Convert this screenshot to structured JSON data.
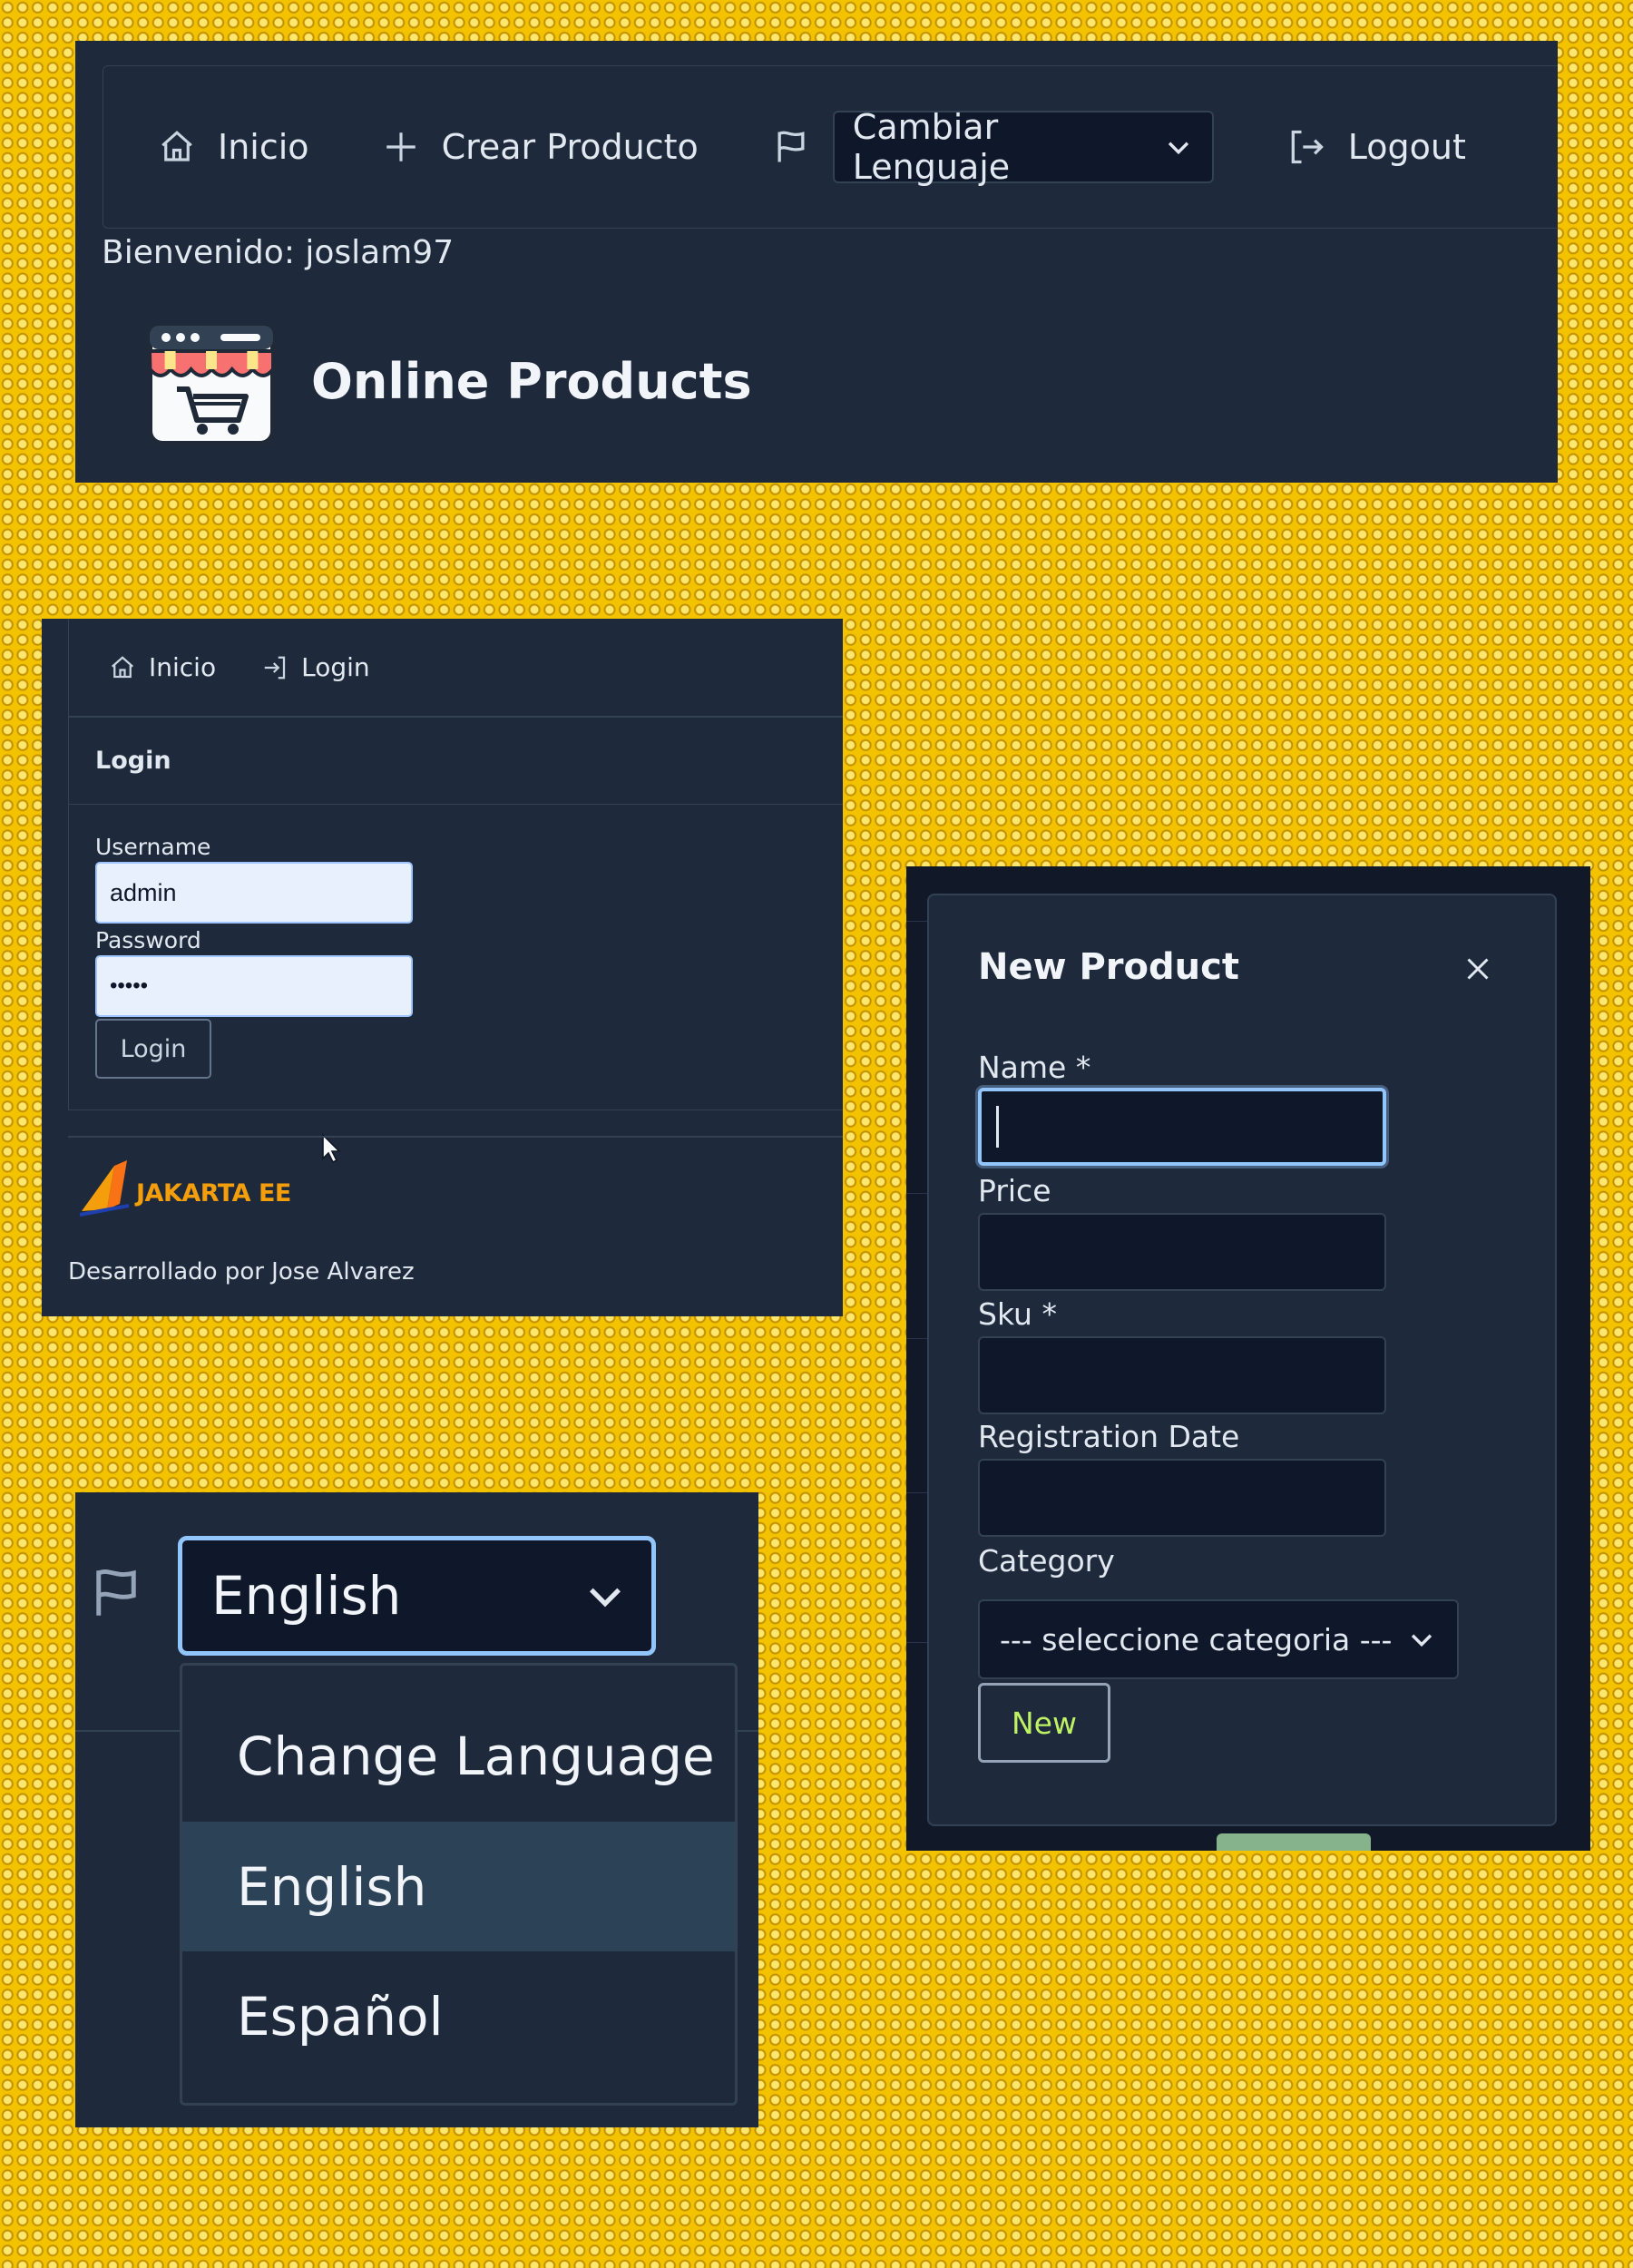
{
  "header": {
    "nav": {
      "home": "Inicio",
      "create_product": "Crear Producto",
      "language_select": "Cambiar Lenguaje",
      "logout": "Logout"
    },
    "welcome": "Bienvenido: joslam97",
    "brand": "Online Products"
  },
  "login_page": {
    "nav": {
      "home": "Inicio",
      "login": "Login"
    },
    "card_title": "Login",
    "username_label": "Username",
    "username_value": "admin",
    "password_label": "Password",
    "password_value": "•••••",
    "login_button": "Login",
    "footer_logo_text": "JAKARTA EE",
    "footer_credit": "Desarrollado por Jose Alvarez"
  },
  "modal": {
    "title": "New Product",
    "fields": {
      "name_label": "Name *",
      "price_label": "Price",
      "sku_label": "Sku *",
      "registration_date_label": "Registration Date",
      "category_label": "Category",
      "category_value": "--- seleccione categoria ---"
    },
    "submit_button": "New"
  },
  "language_dropdown": {
    "selected": "English",
    "options": [
      "Change Language",
      "English",
      "Español"
    ],
    "highlighted_index": 1
  },
  "colors": {
    "panel_bg": "#1e293b",
    "background": "#f4c300",
    "focus_ring": "#93c5fd",
    "accent_button_text": "#bef264"
  }
}
